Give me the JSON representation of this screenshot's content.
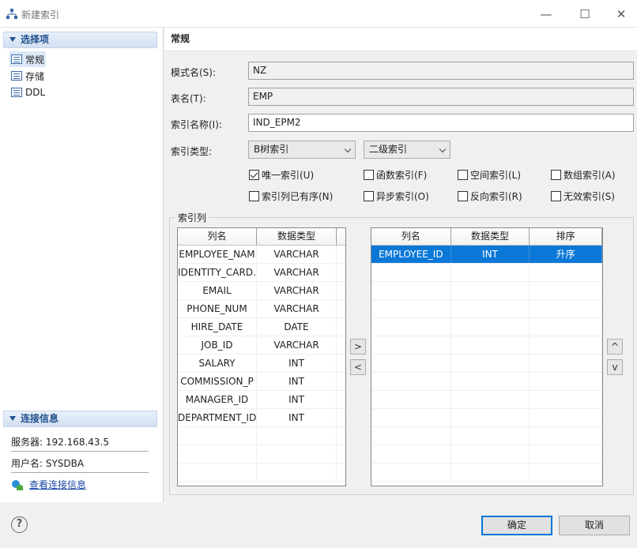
{
  "window": {
    "title": "新建索引",
    "minimize": "—",
    "maximize": "☐",
    "close": "✕"
  },
  "sidebar": {
    "section_title": "选择项",
    "items": [
      {
        "label": "常规",
        "icon": "list-page-icon"
      },
      {
        "label": "存储",
        "icon": "list-page-icon"
      },
      {
        "label": "DDL",
        "icon": "list-page-icon"
      }
    ],
    "conn_title": "连接信息",
    "server": "服务器: 192.168.43.5",
    "user": "用户名: SYSDBA",
    "link": "查看连接信息"
  },
  "form": {
    "header": "常规",
    "schema_label": "模式名(S):",
    "schema_value": "NZ",
    "table_label": "表名(T):",
    "table_value": "EMP",
    "index_label": "索引名称(I):",
    "index_value": "IND_EPM2",
    "type_label": "索引类型:",
    "type_value": "B树索引",
    "level_value": "二级索引",
    "checks": [
      {
        "label": "唯一索引(U)",
        "checked": true
      },
      {
        "label": "函数索引(F)",
        "checked": false
      },
      {
        "label": "空间索引(L)",
        "checked": false
      },
      {
        "label": "数组索引(A)",
        "checked": false
      },
      {
        "label": "索引列已有序(N)",
        "checked": false
      },
      {
        "label": "异步索引(O)",
        "checked": false
      },
      {
        "label": "反向索引(R)",
        "checked": false
      },
      {
        "label": "无效索引(S)",
        "checked": false
      }
    ]
  },
  "columns_group": {
    "label": "索引列",
    "left_headers": [
      "列名",
      "数据类型"
    ],
    "left_rows": [
      [
        "EMPLOYEE_NAM",
        "VARCHAR"
      ],
      [
        "IDENTITY_CARD.",
        "VARCHAR"
      ],
      [
        "EMAIL",
        "VARCHAR"
      ],
      [
        "PHONE_NUM",
        "VARCHAR"
      ],
      [
        "HIRE_DATE",
        "DATE"
      ],
      [
        "JOB_ID",
        "VARCHAR"
      ],
      [
        "SALARY",
        "INT"
      ],
      [
        "COMMISSION_P",
        "INT"
      ],
      [
        "MANAGER_ID",
        "INT"
      ],
      [
        "DEPARTMENT_ID",
        "INT"
      ]
    ],
    "right_headers": [
      "列名",
      "数据类型",
      "排序"
    ],
    "right_rows": [
      [
        "EMPLOYEE_ID",
        "INT",
        "升序"
      ]
    ],
    "add_btn": ">",
    "remove_btn": "<",
    "up_btn": "^",
    "down_btn": "v"
  },
  "footer": {
    "help": "?",
    "ok": "确定",
    "cancel": "取消"
  }
}
